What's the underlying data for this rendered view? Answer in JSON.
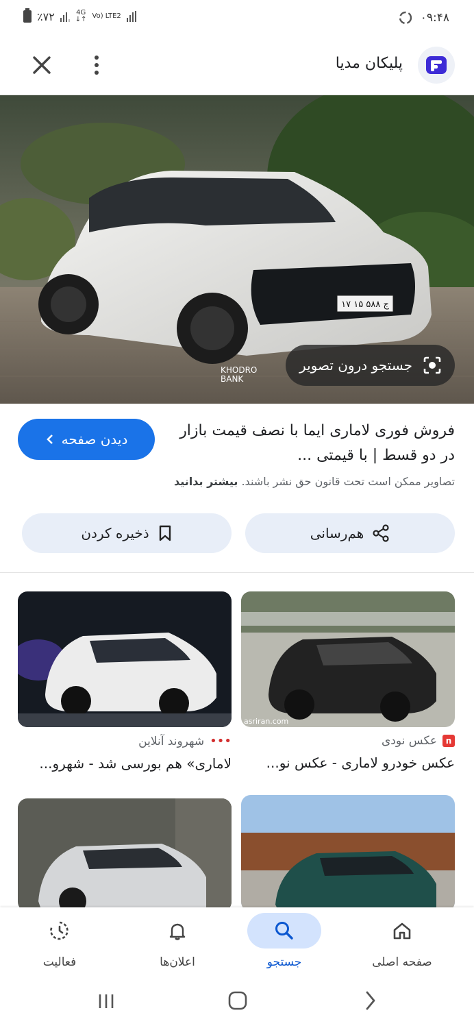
{
  "status_bar": {
    "battery": "٪۷۲",
    "network_4g": "4G",
    "network_lte": "Vo) LTE2",
    "time": "۰۹:۴۸"
  },
  "header": {
    "site_name": "پلیکان مدیا",
    "logo_icon": "pelikan-logo-icon",
    "close_icon": "close-icon",
    "menu_icon": "more-vert-icon"
  },
  "hero": {
    "lens_label": "جستجو درون تصویر",
    "watermark": "KHODRO BANK",
    "plate": "۱۷ ج ۵۸۸ ۱۵"
  },
  "result": {
    "visit_label": "دیدن صفحه",
    "title": "فروش فوری لاماری ایما با نصف قیمت بازار در دو قسط | با قیمتی ...",
    "copyright_text": "تصاویر ممکن است تحت قانون حق نشر باشند.",
    "learn_more": "بیشتر بدانید",
    "share_label": "هم‌رسانی",
    "save_label": "ذخیره کردن"
  },
  "related": [
    {
      "source": "عکس نودی",
      "source_color": "#e53935",
      "title": "عکس خودرو لاماری - عکس نو...",
      "watermark": "asriran.com"
    },
    {
      "source": "شهروند آنلاین",
      "source_color": "#d32f2f",
      "title": "لاماری» هم بورسی شد - شهرو..."
    },
    {
      "source": "",
      "title": ""
    },
    {
      "source": "",
      "title": ""
    }
  ],
  "bottom_nav": {
    "home": "صفحه اصلی",
    "search": "جستجو",
    "notifications": "اعلان‌ها",
    "activity": "فعالیت",
    "active": "search"
  },
  "colors": {
    "accent": "#1a73e8",
    "action_bg": "#e8eef8",
    "nav_active_bg": "#d3e3fd"
  }
}
